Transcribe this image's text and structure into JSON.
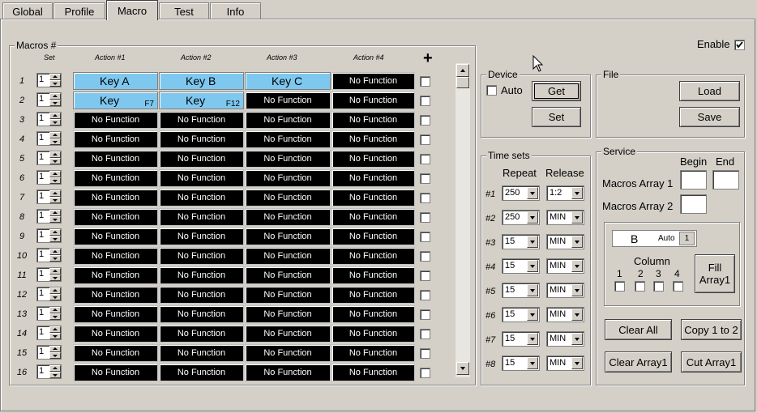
{
  "tabs": [
    {
      "label": "Global"
    },
    {
      "label": "Profile"
    },
    {
      "label": "Macro"
    },
    {
      "label": "Test"
    },
    {
      "label": "Info"
    }
  ],
  "enable": {
    "label": "Enable",
    "checked": true
  },
  "macros": {
    "title": "Macros #",
    "col_set": "Set",
    "col_actions": [
      "Action #1",
      "Action #2",
      "Action #3",
      "Action #4"
    ],
    "add_glyph": "+",
    "rows": [
      {
        "num": "1",
        "set": "1",
        "actions": [
          {
            "t": "key",
            "label": "Key A",
            "sub": ""
          },
          {
            "t": "key",
            "label": "Key B",
            "sub": ""
          },
          {
            "t": "key",
            "label": "Key C",
            "sub": ""
          },
          {
            "t": "nf",
            "label": "No Function"
          }
        ]
      },
      {
        "num": "2",
        "set": "1",
        "actions": [
          {
            "t": "key",
            "label": "Key",
            "sub": "F7"
          },
          {
            "t": "key",
            "label": "Key",
            "sub": "F12"
          },
          {
            "t": "nf",
            "label": "No Function"
          },
          {
            "t": "nf",
            "label": "No Function"
          }
        ]
      },
      {
        "num": "3",
        "set": "1",
        "actions": [
          {
            "t": "nf",
            "label": "No Function"
          },
          {
            "t": "nf",
            "label": "No Function"
          },
          {
            "t": "nf",
            "label": "No Function"
          },
          {
            "t": "nf",
            "label": "No Function"
          }
        ]
      },
      {
        "num": "4",
        "set": "1",
        "actions": [
          {
            "t": "nf",
            "label": "No Function"
          },
          {
            "t": "nf",
            "label": "No Function"
          },
          {
            "t": "nf",
            "label": "No Function"
          },
          {
            "t": "nf",
            "label": "No Function"
          }
        ]
      },
      {
        "num": "5",
        "set": "1",
        "actions": [
          {
            "t": "nf",
            "label": "No Function"
          },
          {
            "t": "nf",
            "label": "No Function"
          },
          {
            "t": "nf",
            "label": "No Function"
          },
          {
            "t": "nf",
            "label": "No Function"
          }
        ]
      },
      {
        "num": "6",
        "set": "1",
        "actions": [
          {
            "t": "nf",
            "label": "No Function"
          },
          {
            "t": "nf",
            "label": "No Function"
          },
          {
            "t": "nf",
            "label": "No Function"
          },
          {
            "t": "nf",
            "label": "No Function"
          }
        ]
      },
      {
        "num": "7",
        "set": "1",
        "actions": [
          {
            "t": "nf",
            "label": "No Function"
          },
          {
            "t": "nf",
            "label": "No Function"
          },
          {
            "t": "nf",
            "label": "No Function"
          },
          {
            "t": "nf",
            "label": "No Function"
          }
        ]
      },
      {
        "num": "8",
        "set": "1",
        "actions": [
          {
            "t": "nf",
            "label": "No Function"
          },
          {
            "t": "nf",
            "label": "No Function"
          },
          {
            "t": "nf",
            "label": "No Function"
          },
          {
            "t": "nf",
            "label": "No Function"
          }
        ]
      },
      {
        "num": "9",
        "set": "1",
        "actions": [
          {
            "t": "nf",
            "label": "No Function"
          },
          {
            "t": "nf",
            "label": "No Function"
          },
          {
            "t": "nf",
            "label": "No Function"
          },
          {
            "t": "nf",
            "label": "No Function"
          }
        ]
      },
      {
        "num": "10",
        "set": "1",
        "actions": [
          {
            "t": "nf",
            "label": "No Function"
          },
          {
            "t": "nf",
            "label": "No Function"
          },
          {
            "t": "nf",
            "label": "No Function"
          },
          {
            "t": "nf",
            "label": "No Function"
          }
        ]
      },
      {
        "num": "11",
        "set": "1",
        "actions": [
          {
            "t": "nf",
            "label": "No Function"
          },
          {
            "t": "nf",
            "label": "No Function"
          },
          {
            "t": "nf",
            "label": "No Function"
          },
          {
            "t": "nf",
            "label": "No Function"
          }
        ]
      },
      {
        "num": "12",
        "set": "1",
        "actions": [
          {
            "t": "nf",
            "label": "No Function"
          },
          {
            "t": "nf",
            "label": "No Function"
          },
          {
            "t": "nf",
            "label": "No Function"
          },
          {
            "t": "nf",
            "label": "No Function"
          }
        ]
      },
      {
        "num": "13",
        "set": "1",
        "actions": [
          {
            "t": "nf",
            "label": "No Function"
          },
          {
            "t": "nf",
            "label": "No Function"
          },
          {
            "t": "nf",
            "label": "No Function"
          },
          {
            "t": "nf",
            "label": "No Function"
          }
        ]
      },
      {
        "num": "14",
        "set": "1",
        "actions": [
          {
            "t": "nf",
            "label": "No Function"
          },
          {
            "t": "nf",
            "label": "No Function"
          },
          {
            "t": "nf",
            "label": "No Function"
          },
          {
            "t": "nf",
            "label": "No Function"
          }
        ]
      },
      {
        "num": "15",
        "set": "1",
        "actions": [
          {
            "t": "nf",
            "label": "No Function"
          },
          {
            "t": "nf",
            "label": "No Function"
          },
          {
            "t": "nf",
            "label": "No Function"
          },
          {
            "t": "nf",
            "label": "No Function"
          }
        ]
      },
      {
        "num": "16",
        "set": "1",
        "actions": [
          {
            "t": "nf",
            "label": "No Function"
          },
          {
            "t": "nf",
            "label": "No Function"
          },
          {
            "t": "nf",
            "label": "No Function"
          },
          {
            "t": "nf",
            "label": "No Function"
          }
        ]
      }
    ]
  },
  "device": {
    "title": "Device",
    "auto_label": "Auto",
    "get_label": "Get",
    "set_label": "Set"
  },
  "file": {
    "title": "File",
    "load_label": "Load",
    "save_label": "Save"
  },
  "timesets": {
    "title": "Time sets",
    "col_repeat": "Repeat",
    "col_release": "Release",
    "rows": [
      {
        "label": "#1",
        "repeat": "250",
        "release": "1:2"
      },
      {
        "label": "#2",
        "repeat": "250",
        "release": "MIN"
      },
      {
        "label": "#3",
        "repeat": "15",
        "release": "MIN"
      },
      {
        "label": "#4",
        "repeat": "15",
        "release": "MIN"
      },
      {
        "label": "#5",
        "repeat": "15",
        "release": "MIN"
      },
      {
        "label": "#6",
        "repeat": "15",
        "release": "MIN"
      },
      {
        "label": "#7",
        "repeat": "15",
        "release": "MIN"
      },
      {
        "label": "#8",
        "repeat": "15",
        "release": "MIN"
      }
    ]
  },
  "service": {
    "title": "Service",
    "begin_label": "Begin",
    "end_label": "End",
    "array1_label": "Macros Array 1",
    "array2_label": "Macros Array 2",
    "key_display": "B",
    "auto_label": "Auto",
    "auto_value": "1",
    "column_label": "Column",
    "columns": [
      "1",
      "2",
      "3",
      "4"
    ],
    "fill_label": "Fill Array1",
    "clear_all_label": "Clear All",
    "copy_label": "Copy 1 to 2",
    "clear_array_label": "Clear Array1",
    "cut_array_label": "Cut Array1"
  }
}
